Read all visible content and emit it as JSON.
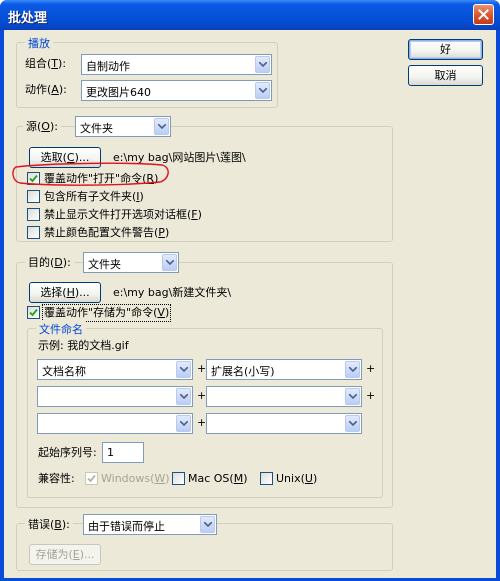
{
  "window": {
    "title": "批处理"
  },
  "buttons": {
    "ok": "好",
    "cancel": "取消"
  },
  "play": {
    "legend": "播放",
    "set_label": "组合(",
    "set_key": "T",
    "set_close": "):",
    "set_value": "自制动作",
    "action_label": "动作(",
    "action_key": "A",
    "action_close": "):",
    "action_value": "更改图片640"
  },
  "source": {
    "label": "源(",
    "key": "O",
    "close": "):",
    "value": "文件夹",
    "choose_label": "选取(",
    "choose_key": "C",
    "choose_close": ")...",
    "path": "e:\\my bag\\网站图片\\莲图\\",
    "options": [
      {
        "text": "覆盖动作\"打开\"命令(",
        "key": "R",
        "close": ")",
        "checked": true
      },
      {
        "text": "包含所有子文件夹(",
        "key": "I",
        "close": ")",
        "checked": false
      },
      {
        "text": "禁止显示文件打开选项对话框(",
        "key": "F",
        "close": ")",
        "checked": false
      },
      {
        "text": "禁止颜色配置文件警告(",
        "key": "P",
        "close": ")",
        "checked": false
      }
    ]
  },
  "destination": {
    "label": "目的(",
    "key": "D",
    "close": "):",
    "value": "文件夹",
    "choose_label": "选择(",
    "choose_key": "H",
    "choose_close": ")...",
    "path": "e:\\my bag\\新建文件夹\\",
    "override_save": {
      "text": "覆盖动作\"存储为\"命令(",
      "key": "V",
      "close": ")",
      "checked": true
    }
  },
  "file_naming": {
    "legend": "文件命名",
    "example": "示例: 我的文档.gif",
    "fields": [
      [
        "文档名称",
        "扩展名(小写)"
      ],
      [
        "",
        ""
      ],
      [
        "",
        ""
      ]
    ],
    "plus": "+",
    "start_serial_label": "起始序列号:",
    "start_serial_value": "1",
    "compat_label": "兼容性:",
    "compat": [
      {
        "text": "Windows(",
        "key": "W",
        "close": ")",
        "checked": true,
        "disabled": true
      },
      {
        "text": "Mac OS(",
        "key": "M",
        "close": ")",
        "checked": false,
        "disabled": false
      },
      {
        "text": "Unix(",
        "key": "U",
        "close": ")",
        "checked": false,
        "disabled": false
      }
    ]
  },
  "errors": {
    "label": "错误(",
    "key": "B",
    "close": "):",
    "value": "由于错误而停止",
    "save_as_label": "存储为(",
    "save_as_key": "E",
    "save_as_close": ")..."
  },
  "colors": {
    "title_bar": "#0552da",
    "legend": "#0046d5",
    "face": "#ece9d8",
    "annotation": "#e0141e"
  }
}
